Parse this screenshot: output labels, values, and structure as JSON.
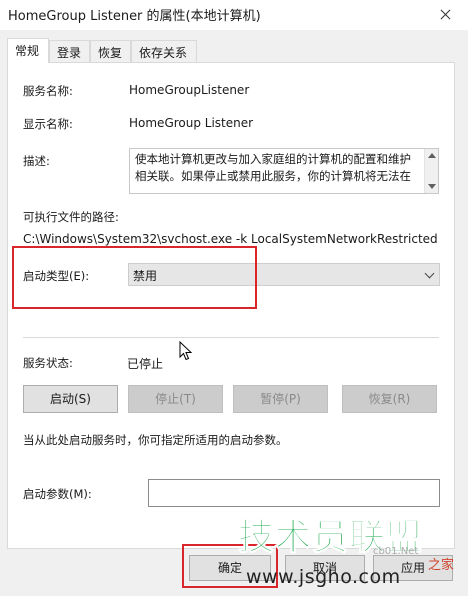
{
  "window": {
    "title": "HomeGroup Listener 的属性(本地计算机)"
  },
  "tabs": [
    {
      "label": "常规",
      "active": true
    },
    {
      "label": "登录",
      "active": false
    },
    {
      "label": "恢复",
      "active": false
    },
    {
      "label": "依存关系",
      "active": false
    }
  ],
  "general": {
    "service_name_label": "服务名称:",
    "service_name_value": "HomeGroupListener",
    "display_name_label": "显示名称:",
    "display_name_value": "HomeGroup Listener",
    "description_label": "描述:",
    "description_value": "使本地计算机更改与加入家庭组的计算机的配置和维护相关联。如果停止或禁用此服务，你的计算机将无法在",
    "exe_path_label": "可执行文件的路径:",
    "exe_path_value": "C:\\Windows\\System32\\svchost.exe -k LocalSystemNetworkRestricted",
    "startup_type_label": "启动类型(E):",
    "startup_type_value": "禁用",
    "service_status_label": "服务状态:",
    "service_status_value": "已停止",
    "buttons": {
      "start": "启动(S)",
      "stop": "停止(T)",
      "pause": "暂停(P)",
      "resume": "恢复(R)"
    },
    "hint_text": "当从此处启动服务时，你可指定所适用的启动参数。",
    "start_params_label": "启动参数(M):",
    "start_params_value": ""
  },
  "footer": {
    "ok": "确定",
    "cancel": "取消",
    "apply": "应用"
  },
  "watermark": {
    "brand": "技术员联盟",
    "url": "www.jsgho.com",
    "tag": "之家",
    "faint": "cb01.Net"
  },
  "colors": {
    "highlight_box": "#d9262b",
    "watermark_green": "#1aa84a"
  }
}
